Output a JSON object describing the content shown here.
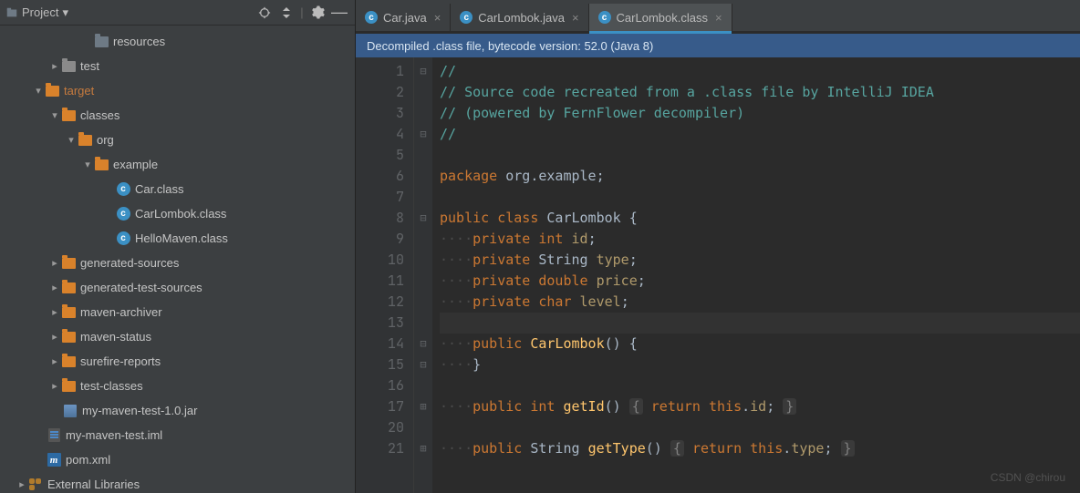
{
  "sidebar": {
    "title": "Project",
    "items": {
      "resources": "resources",
      "test": "test",
      "target": "target",
      "classes": "classes",
      "org": "org",
      "example": "example",
      "car_class": "Car.class",
      "carlombok_class": "CarLombok.class",
      "hellomaven_class": "HelloMaven.class",
      "gen_sources": "generated-sources",
      "gen_test_sources": "generated-test-sources",
      "maven_archiver": "maven-archiver",
      "maven_status": "maven-status",
      "surefire": "surefire-reports",
      "test_classes": "test-classes",
      "jar": "my-maven-test-1.0.jar",
      "iml": "my-maven-test.iml",
      "pom": "pom.xml",
      "ext_libs": "External Libraries"
    }
  },
  "tabs": [
    {
      "label": "Car.java",
      "active": false,
      "closable": true
    },
    {
      "label": "CarLombok.java",
      "active": false,
      "closable": true
    },
    {
      "label": "CarLombok.class",
      "active": true,
      "closable": true
    }
  ],
  "banner": "Decompiled .class file, bytecode version: 52.0 (Java 8)",
  "code_lines": [
    1,
    2,
    3,
    4,
    5,
    6,
    7,
    8,
    9,
    10,
    11,
    12,
    13,
    14,
    15,
    16,
    17,
    20,
    21
  ],
  "code": {
    "l1": "//",
    "l2": "// Source code recreated from a .class file by IntelliJ IDEA",
    "l3": "// (powered by FernFlower decompiler)",
    "l4": "//",
    "pkg_kw": "package ",
    "pkg_name": "org.example",
    "cls_decl_kw": "public class ",
    "cls_name": "CarLombok",
    "brace_open": " {",
    "brace_close": "}",
    "f_id": "id",
    "f_type": "type",
    "f_price": "price",
    "f_level": "level",
    "t_int": "int",
    "t_string": "String",
    "t_double": "double",
    "t_char": "char",
    "kw_private": "private",
    "kw_public": "public",
    "kw_return": "return",
    "kw_this": "this",
    "ctor": "CarLombok",
    "getId": "getId",
    "getType": "getType",
    "dots": "········"
  },
  "watermark": "CSDN @chirou"
}
